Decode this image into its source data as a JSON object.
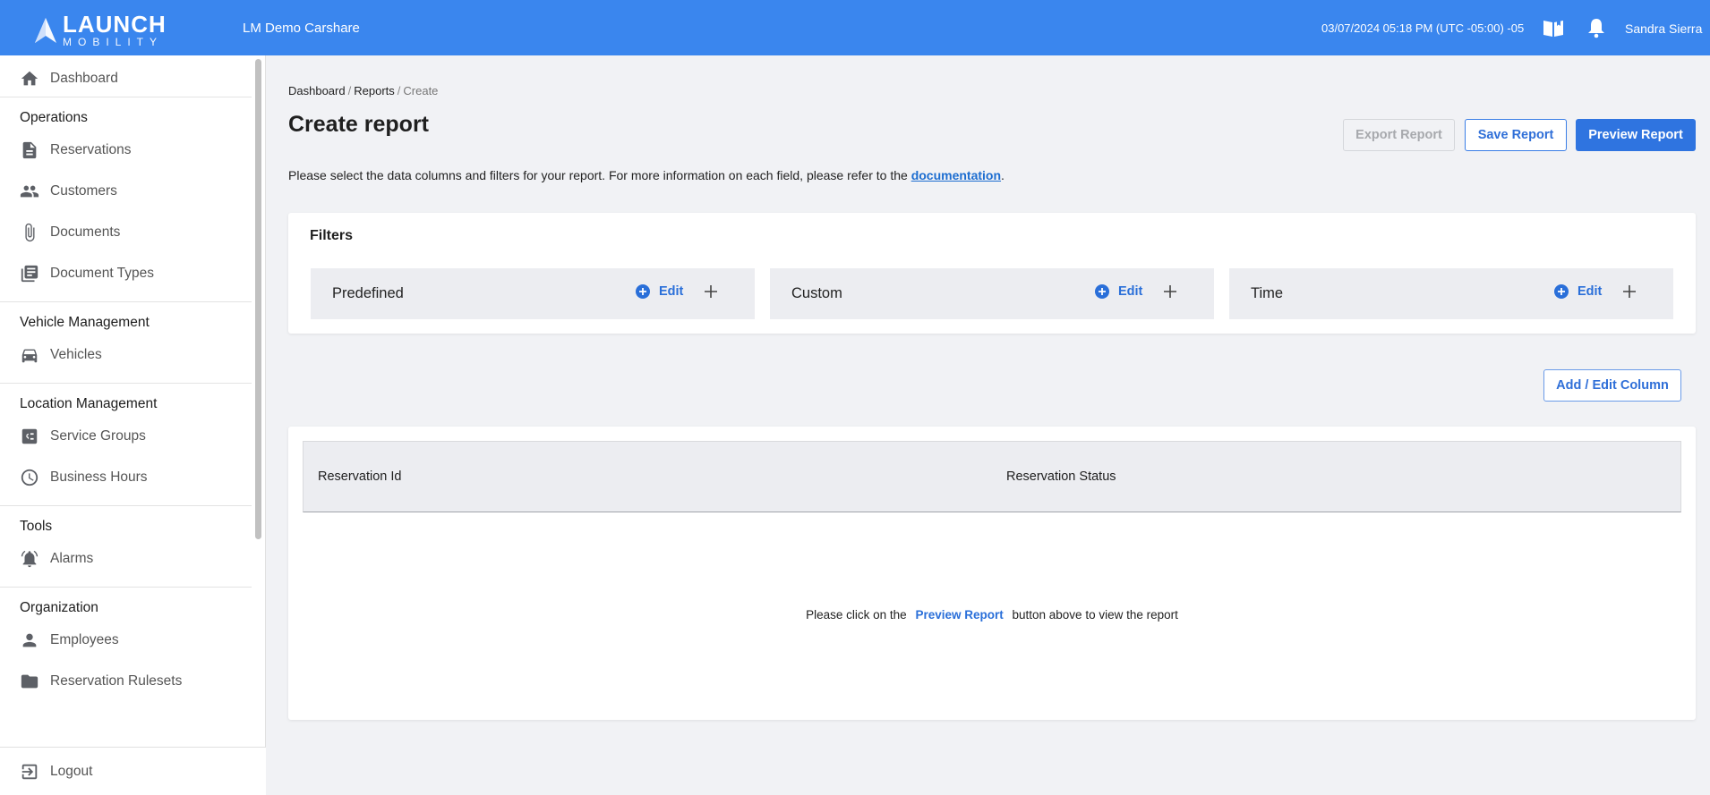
{
  "header": {
    "logo_word": "LAUNCH",
    "logo_sub": "MOBILITY",
    "org_name": "LM Demo Carshare",
    "datetime": "03/07/2024 05:18 PM (UTC -05:00) -05",
    "user_name": "Sandra Sierra",
    "icons": [
      "book-icon",
      "bell-icon"
    ]
  },
  "sidebar": {
    "dashboard": "Dashboard",
    "sections": [
      {
        "title": "Operations",
        "items": [
          {
            "label": "Reservations",
            "icon": "file-icon"
          },
          {
            "label": "Customers",
            "icon": "people-icon"
          },
          {
            "label": "Documents",
            "icon": "paperclip-icon"
          },
          {
            "label": "Document Types",
            "icon": "library-icon"
          }
        ]
      },
      {
        "title": "Vehicle Management",
        "items": [
          {
            "label": "Vehicles",
            "icon": "car-icon"
          }
        ]
      },
      {
        "title": "Location Management",
        "items": [
          {
            "label": "Service Groups",
            "icon": "checklist-icon"
          },
          {
            "label": "Business Hours",
            "icon": "clock-icon"
          }
        ]
      },
      {
        "title": "Tools",
        "items": [
          {
            "label": "Alarms",
            "icon": "alarm-icon"
          }
        ]
      },
      {
        "title": "Organization",
        "items": [
          {
            "label": "Employees",
            "icon": "person-icon"
          },
          {
            "label": "Reservation Rulesets",
            "icon": "folder-icon"
          }
        ]
      }
    ],
    "logout": "Logout"
  },
  "main": {
    "breadcrumb": [
      "Dashboard",
      "Reports",
      "Create"
    ],
    "title": "Create report",
    "buttons": {
      "export": "Export Report",
      "save": "Save Report",
      "preview": "Preview Report",
      "add_column": "Add / Edit Column"
    },
    "intro_text": "Please select the data columns and filters for your report. For more information on each field, please refer to the ",
    "intro_link": "documentation",
    "intro_end": ".",
    "filters": {
      "title": "Filters",
      "edit_label": "Edit",
      "groups": [
        "Predefined",
        "Custom",
        "Time"
      ]
    },
    "table": {
      "columns": [
        "Reservation Id",
        "Reservation Status"
      ],
      "empty_before": "Please click on the",
      "empty_link": "Preview Report",
      "empty_after": "button above to view the report"
    }
  },
  "colors": {
    "brand_blue": "#3a86ee",
    "link_blue": "#2a6fd9"
  }
}
